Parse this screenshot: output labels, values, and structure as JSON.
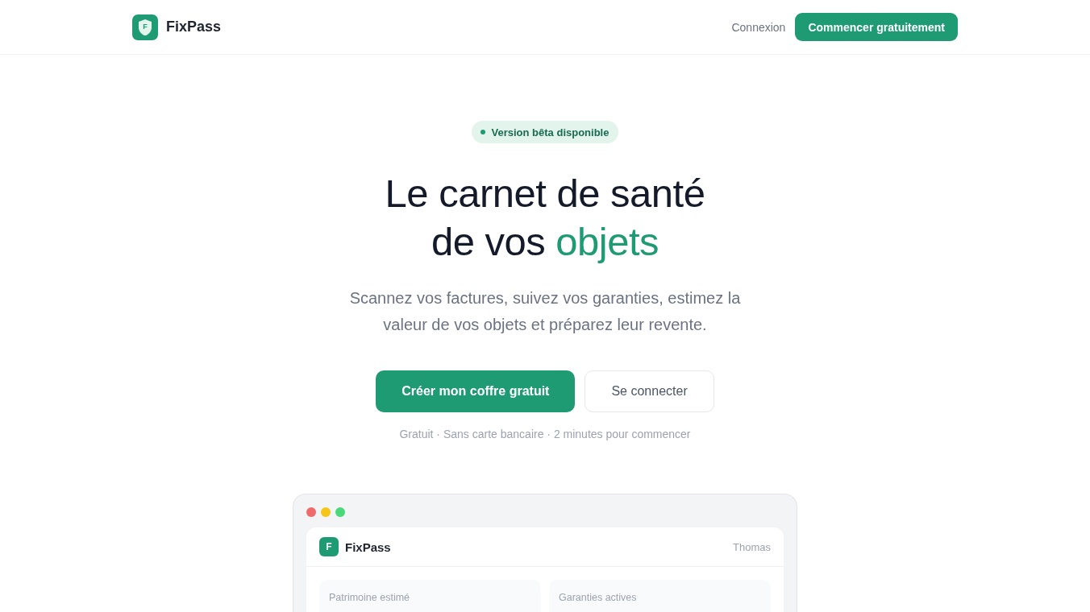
{
  "header": {
    "logo_letter": "F",
    "brand": "FixPass",
    "nav": [
      {
        "label": "Connexion",
        "kind": "link"
      },
      {
        "label": "Commencer gratuitement",
        "kind": "primary"
      }
    ]
  },
  "hero": {
    "badge": "Version bêta disponible",
    "title": [
      {
        "text": "Le carnet de santé de vos ",
        "highlight": false
      },
      {
        "text": "objets",
        "highlight": true
      }
    ],
    "description": "Scannez vos factures, suivez vos garanties, estimez la valeur de vos objets et préparez leur revente.",
    "actions": [
      {
        "label": "Créer mon coffre gratuit",
        "kind": "primary"
      },
      {
        "label": "Se connecter",
        "kind": "secondary"
      }
    ],
    "note": "Gratuit · Sans carte bancaire · 2 minutes pour commencer"
  },
  "preview": {
    "window_dots": [
      {
        "color": "#ef6b6b"
      },
      {
        "color": "#f5c518"
      },
      {
        "color": "#4ad97a"
      }
    ],
    "logo_letter": "F",
    "app_name": "FixPass",
    "user": "Thomas",
    "stats": [
      {
        "label": "Patrimoine estimé"
      },
      {
        "label": "Garanties actives"
      }
    ]
  }
}
